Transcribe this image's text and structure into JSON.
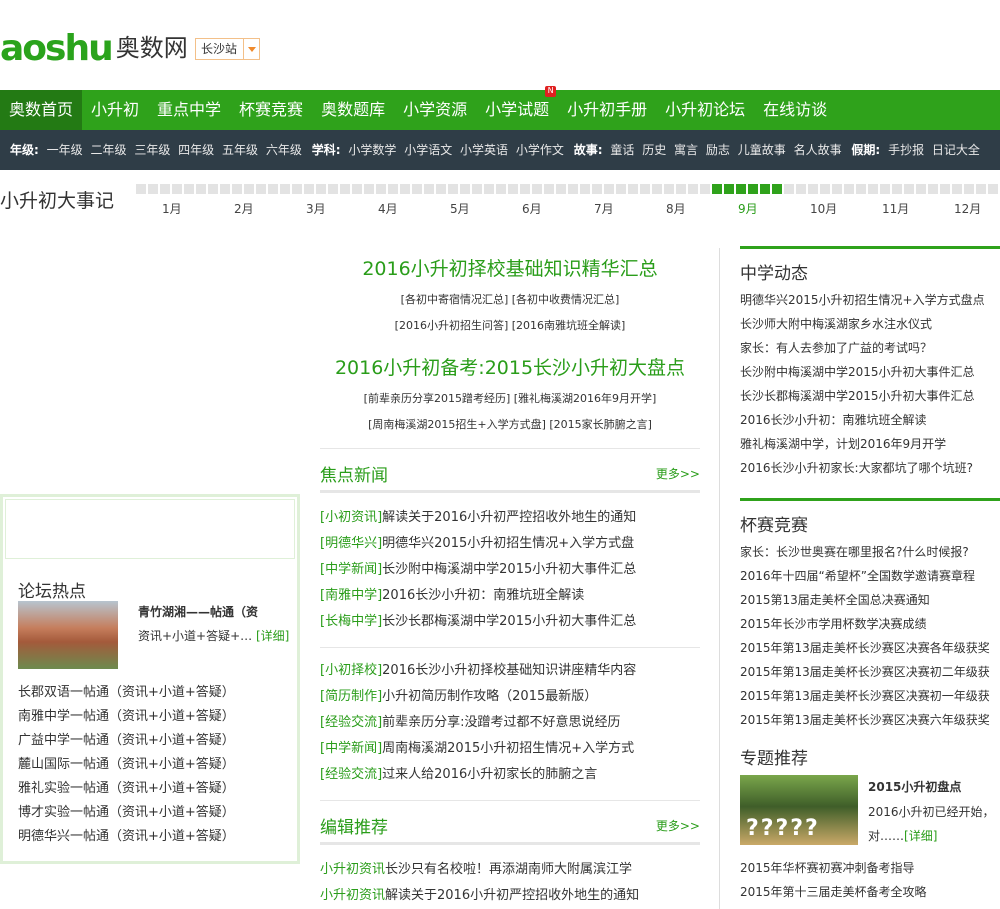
{
  "header": {
    "logo_en": "aoshu",
    "logo_cn": "奥数网",
    "city": "长沙站"
  },
  "nav": {
    "items": [
      "奥数首页",
      "小升初",
      "重点中学",
      "杯赛竞赛",
      "奥数题库",
      "小学资源",
      "小学试题",
      "小升初手册",
      "小升初论坛",
      "在线访谈"
    ],
    "badge": "N"
  },
  "subnav": {
    "grade_label": "年级:",
    "grades": [
      "一年级",
      "二年级",
      "三年级",
      "四年级",
      "五年级",
      "六年级"
    ],
    "subject_label": "学科:",
    "subjects": [
      "小学数学",
      "小学语文",
      "小学英语",
      "小学作文"
    ],
    "story_label": "故事:",
    "stories": [
      "童话",
      "历史",
      "寓言",
      "励志",
      "儿童故事",
      "名人故事"
    ],
    "holiday_label": "假期:",
    "holidays": [
      "手抄报",
      "日记大全"
    ]
  },
  "timeline": {
    "title": "小升初大事记",
    "months": [
      "1月",
      "2月",
      "3月",
      "4月",
      "5月",
      "6月",
      "7月",
      "8月",
      "9月",
      "10月",
      "11月",
      "12月"
    ],
    "active_month": "9月"
  },
  "headlines": [
    {
      "title": "2016小升初择校基础知识精华汇总",
      "links": [
        "[各初中寄宿情况汇总]",
        "[各初中收费情况汇总]",
        "[2016小升初招生问答]",
        "[2016南雅坑班全解读]"
      ]
    },
    {
      "title": "2016小升初备考:2015长沙小升初大盘点",
      "links": [
        "[前辈亲历分享2015蹭考经历]",
        "[雅礼梅溪湖2016年9月开学]",
        "[周南梅溪湖2015招生+入学方式盘]",
        "[2015家长肺腑之言]"
      ]
    }
  ],
  "focus": {
    "title": "焦点新闻",
    "more": "更多>>",
    "group1": [
      {
        "tag": "[小初资讯]",
        "text": "解读关于2016小升初严控招收外地生的通知"
      },
      {
        "tag": "[明德华兴]",
        "text": "明德华兴2015小升初招生情况+入学方式盘"
      },
      {
        "tag": "[中学新闻]",
        "text": "长沙附中梅溪湖中学2015小升初大事件汇总"
      },
      {
        "tag": "[南雅中学]",
        "text": "2016长沙小升初：南雅坑班全解读"
      },
      {
        "tag": "[长梅中学]",
        "text": "长沙长郡梅溪湖中学2015小升初大事件汇总"
      }
    ],
    "group2": [
      {
        "tag": "[小初择校]",
        "text": "2016长沙小升初择校基础知识讲座精华内容"
      },
      {
        "tag": "[简历制作]",
        "text": "小升初简历制作攻略（2015最新版）"
      },
      {
        "tag": "[经验交流]",
        "text": "前辈亲历分享:没蹭考过都不好意思说经历"
      },
      {
        "tag": "[中学新闻]",
        "text": "周南梅溪湖2015小升初招生情况+入学方式"
      },
      {
        "tag": "[经验交流]",
        "text": "过来人给2016小升初家长的肺腑之言"
      }
    ]
  },
  "editor": {
    "title": "编辑推荐",
    "more": "更多>>",
    "items": [
      {
        "tag": "小升初资讯",
        "text": "长沙只有名校啦！再添湖南师大附属滨江学"
      },
      {
        "tag": "小升初资讯",
        "text": "解读关于2016小升初严控招收外地生的通知"
      }
    ]
  },
  "middle_news": {
    "title": "中学动态",
    "items": [
      "明德华兴2015小升初招生情况+入学方式盘点",
      "长沙师大附中梅溪湖家乡水注水仪式",
      "家长：有人去参加了广益的考试吗？",
      "长沙附中梅溪湖中学2015小升初大事件汇总",
      "长沙长郡梅溪湖中学2015小升初大事件汇总",
      "2016长沙小升初：南雅坑班全解读",
      "雅礼梅溪湖中学，计划2016年9月开学",
      "2016长沙小升初家长:大家都坑了哪个坑班?"
    ]
  },
  "contest": {
    "title": "杯赛竞赛",
    "items": [
      "家长：长沙世奥赛在哪里报名?什么时候报?",
      "2016年十四届“希望杯”全国数学邀请赛章程",
      "2015第13届走美杯全国总决赛通知",
      "2015年长沙市学用杯数学决赛成绩",
      "2015年第13届走美杯长沙赛区决赛各年级获奖",
      "2015年第13届走美杯长沙赛区决赛初二年级获",
      "2015年第13届走美杯长沙赛区决赛初一年级获",
      "2015年第13届走美杯长沙赛区决赛六年级获奖"
    ]
  },
  "topic": {
    "title": "专题推荐",
    "card_title": "2015小升初盘点",
    "card_desc": "2016小升初已经开始，对……",
    "card_detail": "[详细]",
    "items": [
      "2015年华杯赛初赛冲刺备考指导",
      "2015年第十三届走美杯备考全攻略"
    ]
  },
  "forum": {
    "title": "论坛热点",
    "thumb_title": "青竹湖湘——帖通（资",
    "thumb_desc": "资讯+小道+答疑+…",
    "thumb_detail": "[详细]",
    "items": [
      "长郡双语一帖通（资讯+小道+答疑）",
      "南雅中学一帖通（资讯+小道+答疑）",
      "广益中学一帖通（资讯+小道+答疑）",
      "麓山国际一帖通（资讯+小道+答疑）",
      "雅礼实验一帖通（资讯+小道+答疑）",
      "博才实验一帖通（资讯+小道+答疑）",
      "明德华兴一帖通（资讯+小道+答疑）"
    ]
  }
}
